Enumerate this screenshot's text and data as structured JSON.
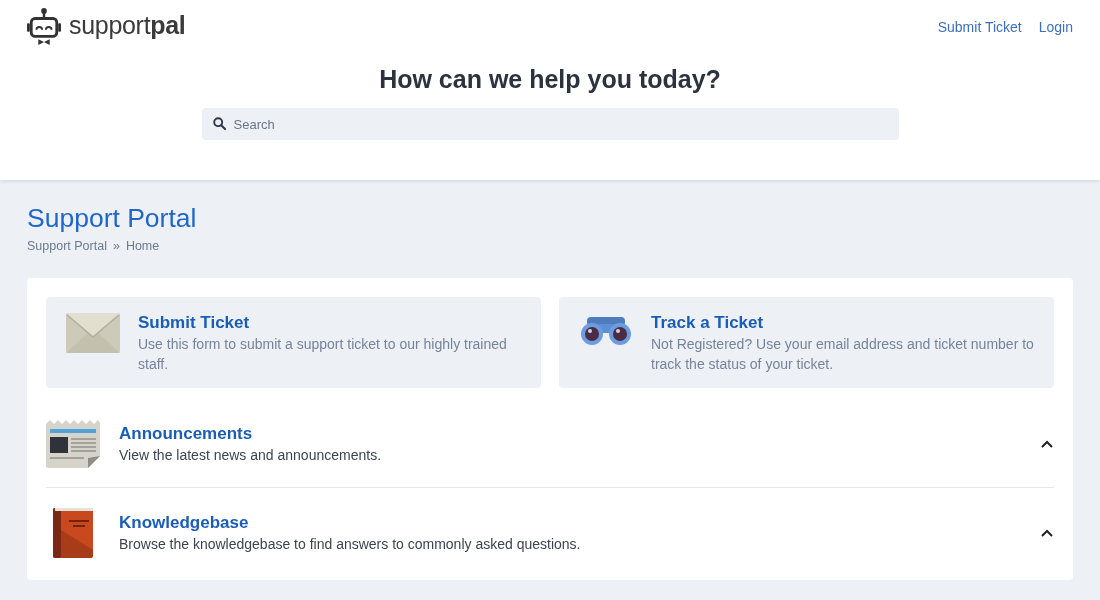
{
  "header": {
    "logo": "support**pal**",
    "nav": [
      {
        "label": "Submit Ticket"
      },
      {
        "label": "Login"
      }
    ]
  },
  "hero": {
    "title": "How can we help you today?",
    "search": {
      "placeholder": "Search"
    }
  },
  "page": {
    "title": "Support Portal",
    "breadcrumbs": {
      "items": [
        {
          "label": "Support Portal"
        },
        {
          "label": "Home"
        }
      ],
      "separator": "»"
    }
  },
  "cards": [
    {
      "kind": "envelope",
      "title": "Submit Ticket",
      "description": "Use this form to submit a support ticket to our highly trained staff."
    },
    {
      "kind": "binoculars",
      "title": "Track a Ticket",
      "description": "Not Registered? Use your email address and ticket number to track the status of your ticket."
    }
  ],
  "sections": [
    {
      "kind": "newspaper",
      "title": "Announcements",
      "description": "View the latest news and announcements.",
      "expanded": true
    },
    {
      "kind": "book",
      "title": "Knowledgebase",
      "description": "Browse the knowledgebase to find answers to commonly asked questions.",
      "expanded": true
    }
  ]
}
